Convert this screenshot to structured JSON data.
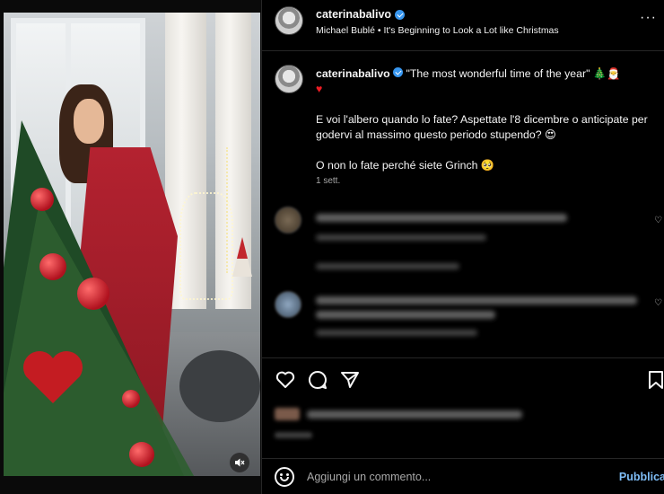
{
  "post": {
    "username": "caterinabalivo",
    "audio": "Michael Bublé • It's Beginning to Look a Lot like Christmas",
    "more_label": "···"
  },
  "caption": {
    "username": "caterinabalivo",
    "line1": "\"The most wonderful time of the year\" 🎄🎅",
    "heart": "♥",
    "paragraph2": "E voi l'albero quando lo fate? Aspettate l'8 dicembre o anticipate per godervi al massimo questo periodo stupendo? 😍",
    "paragraph3": "O non lo fate perché siete Grinch 🥺",
    "time": "1 sett."
  },
  "comments": [
    {
      "blurred": true
    },
    {
      "blurred": true
    }
  ],
  "actions": {
    "like_icon": "heart-outline-icon",
    "comment_icon": "comment-bubble-icon",
    "share_icon": "send-icon",
    "save_icon": "bookmark-icon"
  },
  "media": {
    "mute_icon": "speaker-muted-icon"
  },
  "comment_bar": {
    "placeholder": "Aggiungi un commento...",
    "publish_label": "Pubblica"
  },
  "colors": {
    "background": "#000000",
    "text": "#f5f5f5",
    "muted": "#a8a8a8",
    "verified": "#3897f0",
    "publish": "#7fbdf6",
    "divider": "#262626"
  }
}
